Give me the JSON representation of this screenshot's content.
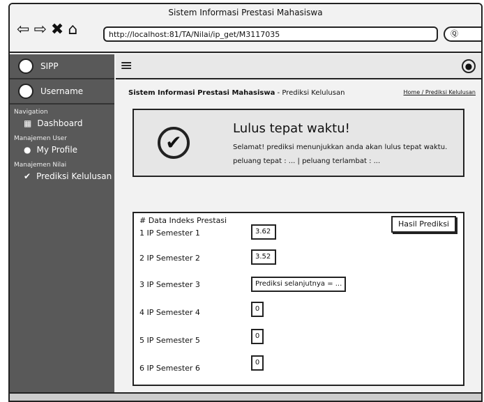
{
  "window": {
    "title": "Sistem Informasi Prestasi Mahasiswa"
  },
  "browser": {
    "url": "http://localhost:81/TA/Nilai/ip_get/M3117035",
    "search_icon": "search-icon"
  },
  "sidebar": {
    "app_name": "SIPP",
    "username": "Username",
    "sections": [
      {
        "label": "Navigation",
        "items": [
          {
            "label": "Dashboard",
            "icon": "dashboard-icon"
          }
        ]
      },
      {
        "label": "Manajemen User",
        "items": [
          {
            "label": "My Profile",
            "icon": "user-icon"
          }
        ]
      },
      {
        "label": "Manajemen Nilai",
        "items": [
          {
            "label": "Prediksi Kelulusan",
            "icon": "check-icon"
          }
        ]
      }
    ]
  },
  "header": {
    "brand": "Sistem Informasi Prestasi Mahasiswa",
    "subtitle": "- Prediksi Kelulusan",
    "breadcrumb": "Home / Prediksi Kelulusan"
  },
  "alert": {
    "title": "Lulus tepat waktu!",
    "line1": "Selamat! prediksi menunjukkan anda akan lulus tepat waktu.",
    "line2": "peluang tepat : ... | peluang terlambat : ..."
  },
  "panel": {
    "title": "# Data Indeks Prestasi",
    "button": "Hasil Prediksi",
    "rows": [
      {
        "label": "1 IP Semester 1",
        "value": "3.62"
      },
      {
        "label": "2 IP Semester 2",
        "value": "3.52"
      },
      {
        "label": "3 IP Semester 3",
        "value": "Prediksi selanjutnya = ..."
      },
      {
        "label": "4 IP Semester 4",
        "value": "0"
      },
      {
        "label": "5 IP Semester 5",
        "value": "0"
      },
      {
        "label": "6 IP Semester 6",
        "value": "0"
      }
    ]
  }
}
